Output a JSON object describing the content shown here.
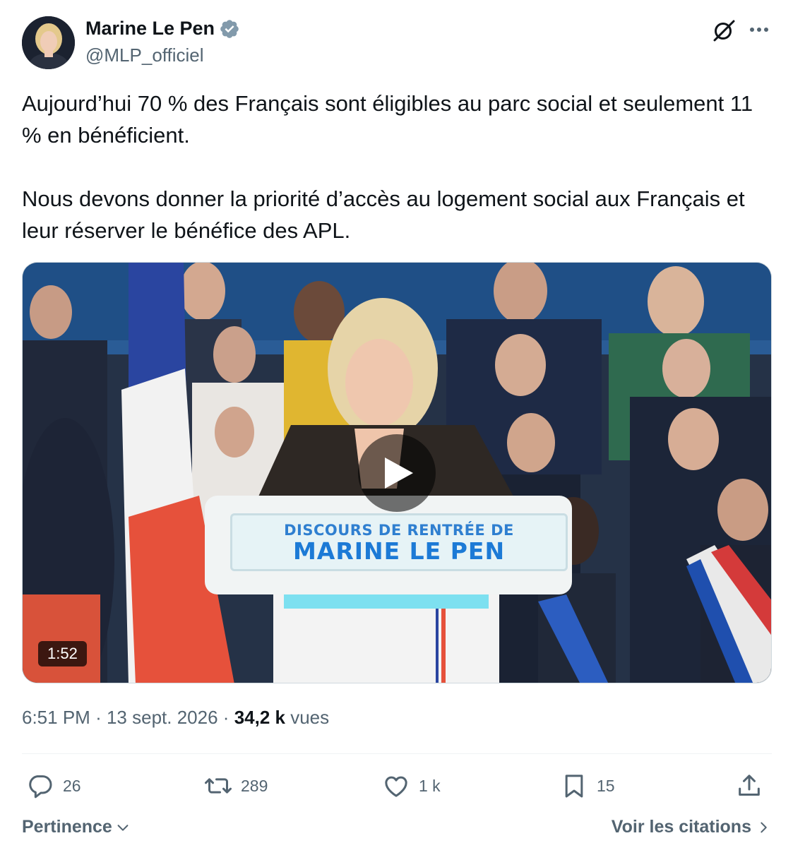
{
  "author": {
    "display_name": "Marine Le Pen",
    "handle": "@MLP_officiel",
    "verified": true
  },
  "tweet": {
    "paragraph1": "Aujourd’hui 70 % des Français sont éligibles au parc social et seulement 11 % en bénéficient.",
    "paragraph2": "Nous devons donner la priorité d’accès au logement social aux Français et leur réserver le bénéfice des APL."
  },
  "video": {
    "duration": "1:52",
    "sign_line1": "DISCOURS DE RENTRÉE DE",
    "sign_line2": "MARINE LE PEN"
  },
  "meta": {
    "time": "6:51 PM",
    "separator": "·",
    "date": "13 sept. 2026",
    "views_count": "34,2 k",
    "views_label": "vues"
  },
  "actions": {
    "replies": "26",
    "reposts": "289",
    "likes": "1 k",
    "bookmarks": "15"
  },
  "footer": {
    "sort_label": "Pertinence",
    "quotes_label": "Voir les citations"
  },
  "colors": {
    "text_primary": "#0f1419",
    "text_secondary": "#536471",
    "verified": "#829aab",
    "divider": "#eff3f4"
  }
}
